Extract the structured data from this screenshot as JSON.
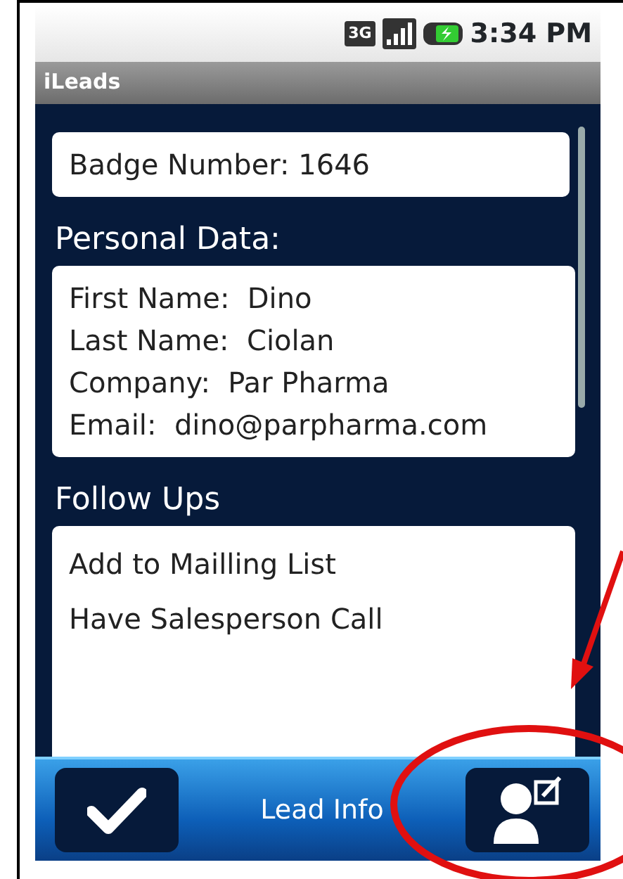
{
  "status_bar": {
    "network": "3G",
    "time": "3:34 PM"
  },
  "window": {
    "title": "iLeads"
  },
  "badge": {
    "label": "Badge Number:",
    "value": "1646"
  },
  "personal_data": {
    "heading": "Personal Data:",
    "fields": [
      {
        "label": "First Name:",
        "value": "Dino"
      },
      {
        "label": "Last Name:",
        "value": "Ciolan"
      },
      {
        "label": "Company:",
        "value": "Par Pharma"
      },
      {
        "label": "Email:",
        "value": "dino@parpharma.com"
      }
    ]
  },
  "follow_ups": {
    "heading": "Follow Ups",
    "items": [
      "Add to Mailling List",
      "Have Salesperson Call"
    ]
  },
  "bottom_bar": {
    "title": "Lead Info"
  }
}
